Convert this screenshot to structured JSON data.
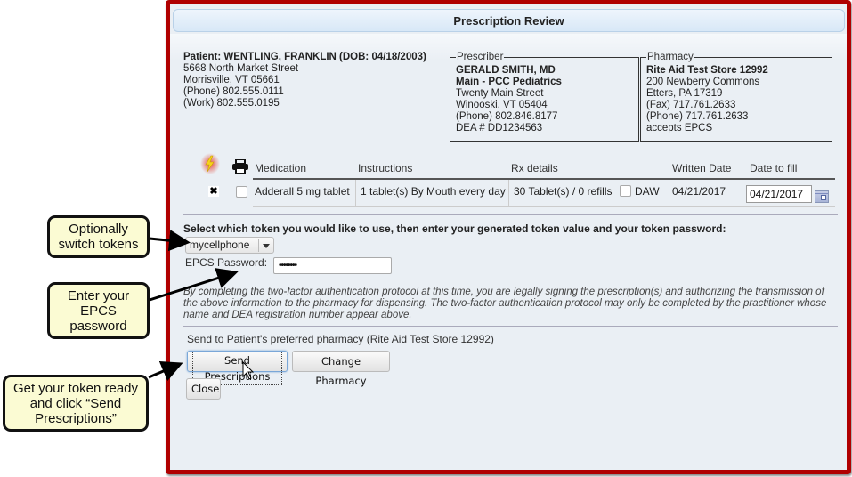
{
  "dialog": {
    "title": "Prescription Review"
  },
  "patient": {
    "name_line": "Patient: WENTLING, FRANKLIN (DOB: 04/18/2003)",
    "address1": "5668 North Market Street",
    "address2": "Morrisville, VT 05661",
    "phone": "(Phone) 802.555.0111",
    "work": "(Work) 802.555.0195"
  },
  "prescriber": {
    "legend": "Prescriber",
    "name": "GERALD SMITH, MD",
    "practice": "Main - PCC Pediatrics",
    "address1": "Twenty Main Street",
    "address2": "Winooski, VT 05404",
    "phone": "(Phone) 802.846.8177",
    "dea": "DEA # DD1234563"
  },
  "pharmacy": {
    "legend": "Pharmacy",
    "name": "Rite Aid Test Store 12992",
    "address1": "200 Newberry Commons",
    "address2": "Etters, PA 17319",
    "fax": "(Fax) 717.761.2633",
    "phone": "(Phone) 717.761.2633",
    "epcs": "accepts EPCS"
  },
  "table": {
    "icons": [
      "lightning-icon",
      "printer-icon"
    ],
    "headers": {
      "medication": "Medication",
      "instructions": "Instructions",
      "rx_details": "Rx details",
      "written_date": "Written Date",
      "date_to_fill": "Date to fill"
    },
    "rows": [
      {
        "medication": "Adderall 5 mg tablet",
        "instructions": "1 tablet(s) By Mouth every day",
        "rx_details": "30 Tablet(s) / 0 refills",
        "daw_label": "DAW",
        "daw_checked": false,
        "print_checked": false,
        "controlled_marker": "✖",
        "written_date": "04/21/2017",
        "date_to_fill": "04/21/2017"
      }
    ]
  },
  "token": {
    "instruction": "Select which token you would like to use, then enter your generated token value and your token password:",
    "selected": "mycellphone",
    "password_label": "EPCS Password:",
    "password_value": "••••••••"
  },
  "legal_text": "By completing the two-factor authentication protocol at this time, you are legally signing the prescription(s) and authorizing the transmission of the above information to the pharmacy for dispensing. The two-factor authentication protocol may only be completed by the practitioner whose name and DEA registration number appear above.",
  "send_to": "Send to Patient's preferred pharmacy (Rite Aid Test Store 12992)",
  "buttons": {
    "send": "Send Prescriptions",
    "change_pharmacy": "Change Pharmacy",
    "close": "Close"
  },
  "callouts": {
    "switch_tokens": "Optionally switch tokens",
    "enter_password": "Enter your EPCS password",
    "get_token": "Get your token ready and click “Send Prescriptions”"
  }
}
